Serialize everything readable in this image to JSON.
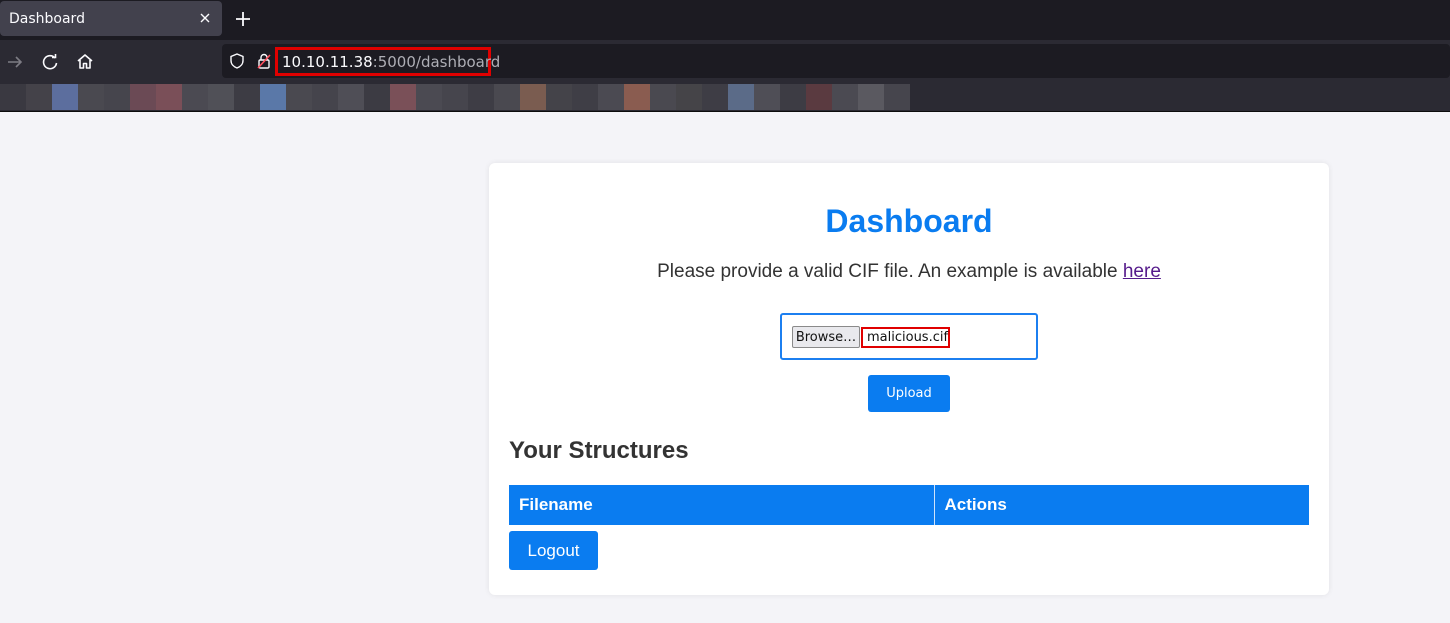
{
  "browser": {
    "tab_title": "Dashboard",
    "url_host": "10.10.11.38",
    "url_rest": ":5000/dashboard",
    "bookmarks_blocks": [
      "#3a3941",
      "#444249",
      "#5c6e9e",
      "#4a4950",
      "#46454d",
      "#6b4a55",
      "#7a4f58",
      "#4b4a52",
      "#505057",
      "#3d3c44",
      "#5a78a8",
      "#4a4950",
      "#45444c",
      "#4f4e56",
      "#3c3b43",
      "#7a5058",
      "#4b4a52",
      "#46454d",
      "#3e3d45",
      "#4a4950",
      "#7a5c50",
      "#444349",
      "#3f3e46",
      "#4b4a52",
      "#8a5c50",
      "#4a4950",
      "#454448",
      "#3e3d45",
      "#5b6b88",
      "#4f4e56",
      "#3d3c44",
      "#5a3a40",
      "#4b4a52",
      "#5a5960",
      "#46454d"
    ]
  },
  "page": {
    "title": "Dashboard",
    "intro_text": "Please provide a valid CIF file. An example is available ",
    "intro_link": "here",
    "browse_label": "Browse…",
    "selected_file": "malicious.cif",
    "upload_label": "Upload",
    "section_title": "Your Structures",
    "table_headers": [
      "Filename",
      "Actions"
    ],
    "logout_label": "Logout"
  },
  "colors": {
    "accent": "#0a7cf0",
    "highlight": "#e00000"
  }
}
